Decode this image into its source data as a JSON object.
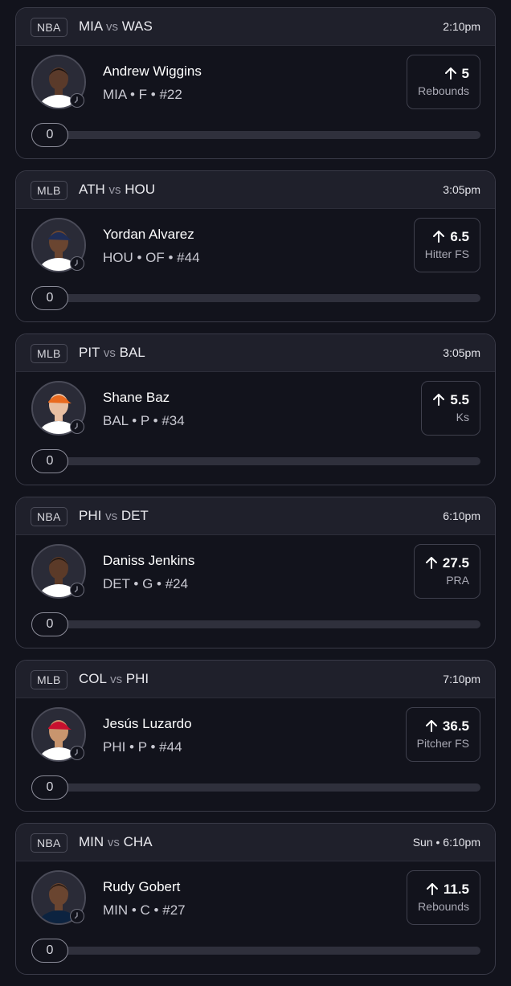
{
  "colors": {
    "background": "#12131c",
    "card_header": "#1f202b",
    "border": "#3a3b48",
    "text_primary": "#ffffff",
    "text_secondary": "#a9a9b4",
    "track": "#2f303c"
  },
  "icons": {
    "stat_direction": "arrow-up-icon",
    "avatar_badge": "clock-icon"
  },
  "cards": [
    {
      "league": "NBA",
      "team_a": "MIA",
      "vs": "vs",
      "team_b": "WAS",
      "time": "2:10pm",
      "player_name": "Andrew Wiggins",
      "player_meta": "MIA • F • #22",
      "stat_value": "5",
      "stat_label": "Rebounds",
      "progress_value": "0",
      "progress_fraction": 0,
      "photo_skin": "#5a3a2a",
      "photo_hair": "#1a1210",
      "photo_jersey": "#ffffff",
      "photo_cap": ""
    },
    {
      "league": "MLB",
      "team_a": "ATH",
      "vs": "vs",
      "team_b": "HOU",
      "time": "3:05pm",
      "player_name": "Yordan Alvarez",
      "player_meta": "HOU • OF • #44",
      "stat_value": "6.5",
      "stat_label": "Hitter FS",
      "progress_value": "0",
      "progress_fraction": 0,
      "photo_skin": "#6a4530",
      "photo_hair": "#1a1210",
      "photo_jersey": "#ffffff",
      "photo_cap": "#1f2d56"
    },
    {
      "league": "MLB",
      "team_a": "PIT",
      "vs": "vs",
      "team_b": "BAL",
      "time": "3:05pm",
      "player_name": "Shane Baz",
      "player_meta": "BAL • P • #34",
      "stat_value": "5.5",
      "stat_label": "Ks",
      "progress_value": "0",
      "progress_fraction": 0,
      "photo_skin": "#e8bfa2",
      "photo_hair": "#8a5a3a",
      "photo_jersey": "#ffffff",
      "photo_cap": "#e96a1f"
    },
    {
      "league": "NBA",
      "team_a": "PHI",
      "vs": "vs",
      "team_b": "DET",
      "time": "6:10pm",
      "player_name": "Daniss Jenkins",
      "player_meta": "DET • G • #24",
      "stat_value": "27.5",
      "stat_label": "PRA",
      "progress_value": "0",
      "progress_fraction": 0,
      "photo_skin": "#5b3a28",
      "photo_hair": "#241812",
      "photo_jersey": "#ffffff",
      "photo_cap": ""
    },
    {
      "league": "MLB",
      "team_a": "COL",
      "vs": "vs",
      "team_b": "PHI",
      "time": "7:10pm",
      "player_name": "Jesús Luzardo",
      "player_meta": "PHI • P • #44",
      "stat_value": "36.5",
      "stat_label": "Pitcher FS",
      "progress_value": "0",
      "progress_fraction": 0,
      "photo_skin": "#c8956e",
      "photo_hair": "#1a1210",
      "photo_jersey": "#ffffff",
      "photo_cap": "#c8102e"
    },
    {
      "league": "NBA",
      "team_a": "MIN",
      "vs": "vs",
      "team_b": "CHA",
      "time": "Sun • 6:10pm",
      "player_name": "Rudy Gobert",
      "player_meta": "MIN • C • #27",
      "stat_value": "11.5",
      "stat_label": "Rebounds",
      "progress_value": "0",
      "progress_fraction": 0,
      "photo_skin": "#6a4530",
      "photo_hair": "#2a1c14",
      "photo_jersey": "#0c2340",
      "photo_cap": ""
    }
  ]
}
